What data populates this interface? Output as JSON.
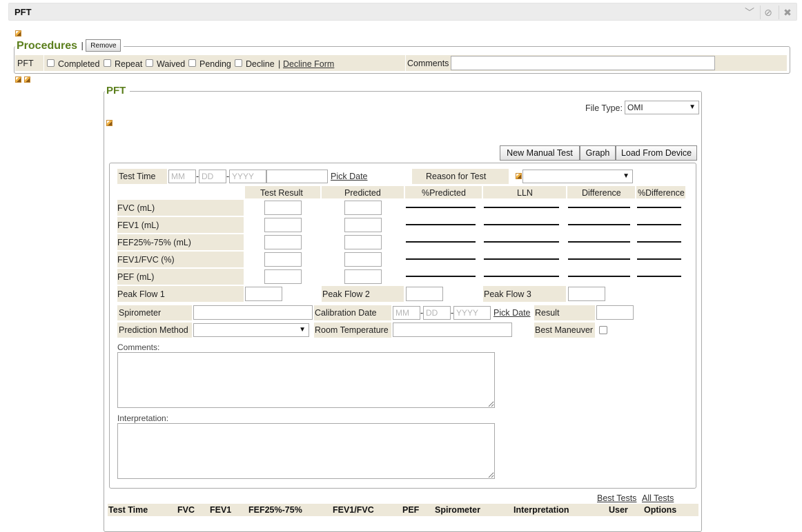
{
  "window": {
    "title": "PFT"
  },
  "procedures": {
    "legend": "Procedures",
    "separator": "|",
    "remove_label": "Remove",
    "row_label": "PFT",
    "options": [
      "Completed",
      "Repeat",
      "Waived",
      "Pending",
      "Decline"
    ],
    "options_separator": "|",
    "decline_form_label": "Decline Form",
    "comments_label": "Comments",
    "comments_value": ""
  },
  "pft": {
    "legend": "PFT",
    "file_type_label": "File Type:",
    "file_type_value": "OMI",
    "toolbar": {
      "new_manual_test": "New Manual Test",
      "graph": "Graph",
      "load_from_device": "Load From Device"
    },
    "test_time": {
      "label": "Test Time",
      "mm_placeholder": "MM",
      "dd_placeholder": "DD",
      "yyyy_placeholder": "YYYY",
      "date_sep": "-",
      "pick_date": "Pick Date"
    },
    "reason_for_test_label": "Reason for Test",
    "reason_for_test_value": "",
    "grid": {
      "headers": [
        "Test Result",
        "Predicted",
        "%Predicted",
        "LLN",
        "Difference",
        "%Difference"
      ],
      "rows": [
        "FVC (mL)",
        "FEV1 (mL)",
        "FEF25%-75% (mL)",
        "FEV1/FVC (%)",
        "PEF (mL)"
      ]
    },
    "peak_flow": {
      "pf1": "Peak Flow 1",
      "pf2": "Peak Flow 2",
      "pf3": "Peak Flow 3"
    },
    "spirometer_label": "Spirometer",
    "calibration": {
      "label": "Calibration Date",
      "mm_placeholder": "MM",
      "dd_placeholder": "DD",
      "yyyy_placeholder": "YYYY",
      "date_sep": "-",
      "pick_date": "Pick Date"
    },
    "result_label": "Result",
    "prediction_method_label": "Prediction Method",
    "room_temperature_label": "Room Temperature",
    "best_maneuver_label": "Best Maneuver",
    "comments_label": "Comments:",
    "interpretation_label": "Interpretation:",
    "links": {
      "best_tests": "Best Tests",
      "all_tests": "All Tests"
    },
    "table_headers": [
      "Test Time",
      "FVC",
      "FEV1",
      "FEF25%-75%",
      "FEV1/FVC",
      "PEF",
      "Spirometer",
      "Interpretation",
      "User",
      "Options"
    ]
  }
}
